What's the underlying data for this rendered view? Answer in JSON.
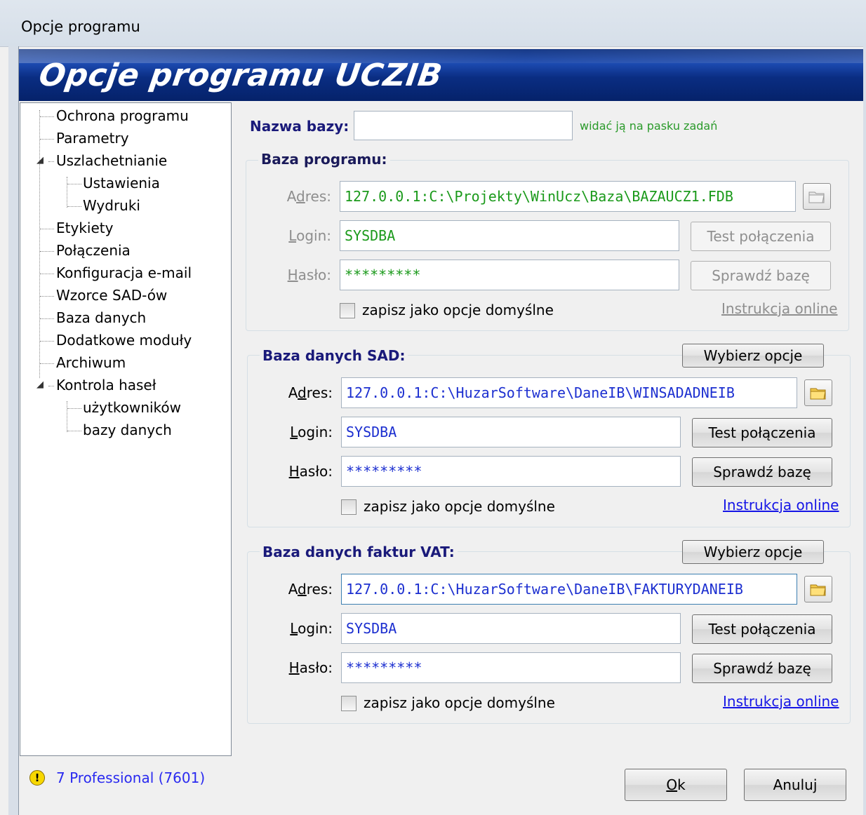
{
  "window": {
    "title": "Opcje programu"
  },
  "banner": {
    "title": "Opcje programu UCZIB"
  },
  "tree": {
    "items": [
      {
        "label": "Ochrona programu"
      },
      {
        "label": "Parametry"
      },
      {
        "label": "Uszlachetnianie",
        "expanded": true
      },
      {
        "label": "Ustawienia"
      },
      {
        "label": "Wydruki"
      },
      {
        "label": "Etykiety"
      },
      {
        "label": "Połączenia"
      },
      {
        "label": "Konfiguracja e-mail"
      },
      {
        "label": "Wzorce SAD-ów"
      },
      {
        "label": "Baza danych"
      },
      {
        "label": "Dodatkowe moduły"
      },
      {
        "label": "Archiwum"
      },
      {
        "label": "Kontrola haseł",
        "expanded": true
      },
      {
        "label": "użytkowników"
      },
      {
        "label": "bazy danych"
      }
    ]
  },
  "db_name": {
    "label": "Nazwa bazy:",
    "value": "",
    "hint": "widać ją na pasku zadań"
  },
  "labels": {
    "adres_pre": "A",
    "adres_acc": "d",
    "adres_post": "res:",
    "login_acc": "L",
    "login_post": "ogin:",
    "haslo_acc": "H",
    "haslo_post": "asło:"
  },
  "program_db": {
    "title": "Baza programu:",
    "address": "127.0.0.1:C:\\Projekty\\WinUcz\\Baza\\BAZAUCZ1.FDB",
    "login": "SYSDBA",
    "password": "*********",
    "test_button": "Test połączenia",
    "check_button": "Sprawdź bazę",
    "save_default": "zapisz jako opcje domyślne",
    "help_link": "Instrukcja online"
  },
  "sad_db": {
    "title": "Baza danych SAD:",
    "choose_button": "Wybierz opcje",
    "address": "127.0.0.1:C:\\HuzarSoftware\\DaneIB\\WINSADADNEIB",
    "login": "SYSDBA",
    "password": "*********",
    "test_button": "Test połączenia",
    "check_button": "Sprawdź bazę",
    "save_default": "zapisz jako opcje domyślne",
    "help_link": "Instrukcja online"
  },
  "vat_db": {
    "title": "Baza danych faktur VAT:",
    "choose_button": "Wybierz opcje",
    "address": "127.0.0.1:C:\\HuzarSoftware\\DaneIB\\FAKTURYDANEIB",
    "login": "SYSDBA",
    "password": "*********",
    "test_button": "Test połączenia",
    "check_button": "Sprawdź bazę",
    "save_default": "zapisz jako opcje domyślne",
    "help_link": "Instrukcja online"
  },
  "status": {
    "text": "7 Professional (7601)",
    "icon": "warning-icon"
  },
  "footer": {
    "ok_acc": "O",
    "ok_post": "k",
    "cancel": "Anuluj"
  },
  "colors": {
    "banner": "#0b2f80",
    "disabled_text": "#1b9a1b",
    "enabled_text": "#1c2fd0",
    "link": "#1515e6"
  }
}
